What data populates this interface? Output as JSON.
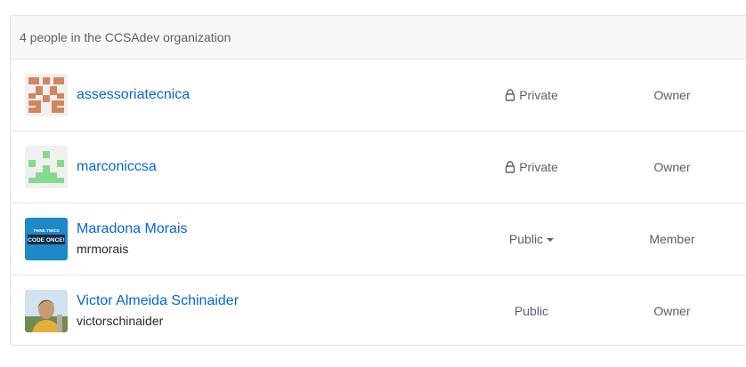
{
  "header": {
    "title": "4 people in the CCSAdev organization"
  },
  "members": [
    {
      "name": "assessoriatecnica",
      "login": "",
      "visibility": "Private",
      "role": "Owner",
      "avatar": "identicon-orange-icon"
    },
    {
      "name": "marconiccsa",
      "login": "",
      "visibility": "Private",
      "role": "Owner",
      "avatar": "identicon-green-icon"
    },
    {
      "name": "Maradona Morais",
      "login": "mrmorais",
      "visibility": "Public",
      "role": "Member",
      "avatar": "think-twice-code-once-avatar",
      "avatar_text_top": "THINK TWICE",
      "avatar_text_bottom": "CODE ONCE!"
    },
    {
      "name": "Victor Almeida Schinaider",
      "login": "victorschinaider",
      "visibility": "Public",
      "role": "Owner",
      "avatar": "photo-avatar"
    }
  ],
  "colors": {
    "link": "#0366d6",
    "identicon_orange": "#d3855e",
    "identicon_green": "#85d98d",
    "avatar_blue": "#1e88c8"
  }
}
